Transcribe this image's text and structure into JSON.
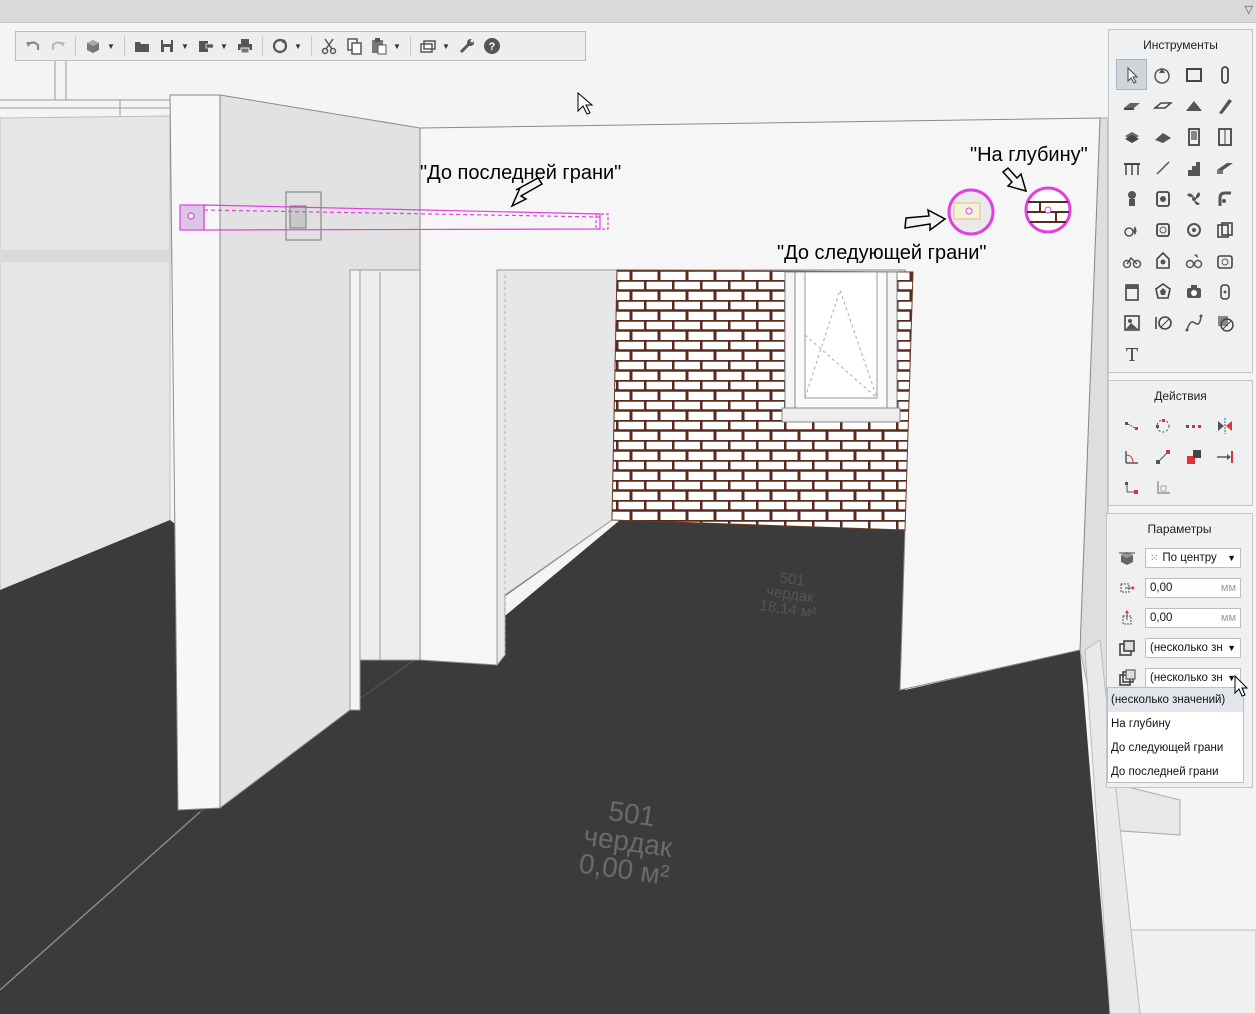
{
  "toolbar": {
    "icons": [
      "undo-icon",
      "redo-icon",
      "3d-view-icon",
      "open-folder-icon",
      "save-icon",
      "export-icon",
      "print-icon",
      "sync-icon",
      "cut-icon",
      "copy-icon",
      "paste-icon",
      "views-icon",
      "settings-wrench-icon",
      "help-icon"
    ]
  },
  "annotations": {
    "last_face": "\"До последней грани\"",
    "next_face": "\"До следующей грани\"",
    "depth": "\"На глубину\""
  },
  "floor_labels": {
    "main": {
      "number": "501",
      "name": "чердак",
      "area": "0,00 м²"
    },
    "far": {
      "number": "501",
      "name": "чердак",
      "area": "18,14 м²"
    }
  },
  "panels": {
    "tools": {
      "title": "Инструменты"
    },
    "actions": {
      "title": "Действия"
    },
    "params": {
      "title": "Параметры",
      "anchor_value": "По центру",
      "offset_x_value": "0,00",
      "offset_x_unit": "мм",
      "offset_y_value": "0,00",
      "offset_y_unit": "мм",
      "select1_value": "(несколько зн",
      "select2_value": "(несколько зн"
    }
  },
  "dropdown_options": [
    "(несколько значений)",
    "На глубину",
    "До следующей грани",
    "До последней грани"
  ],
  "colors": {
    "highlight": "#e040e0",
    "floor": "#3b3b3b",
    "brick_mortar": "#ffffff",
    "brick_line": "#5a2a1c"
  }
}
